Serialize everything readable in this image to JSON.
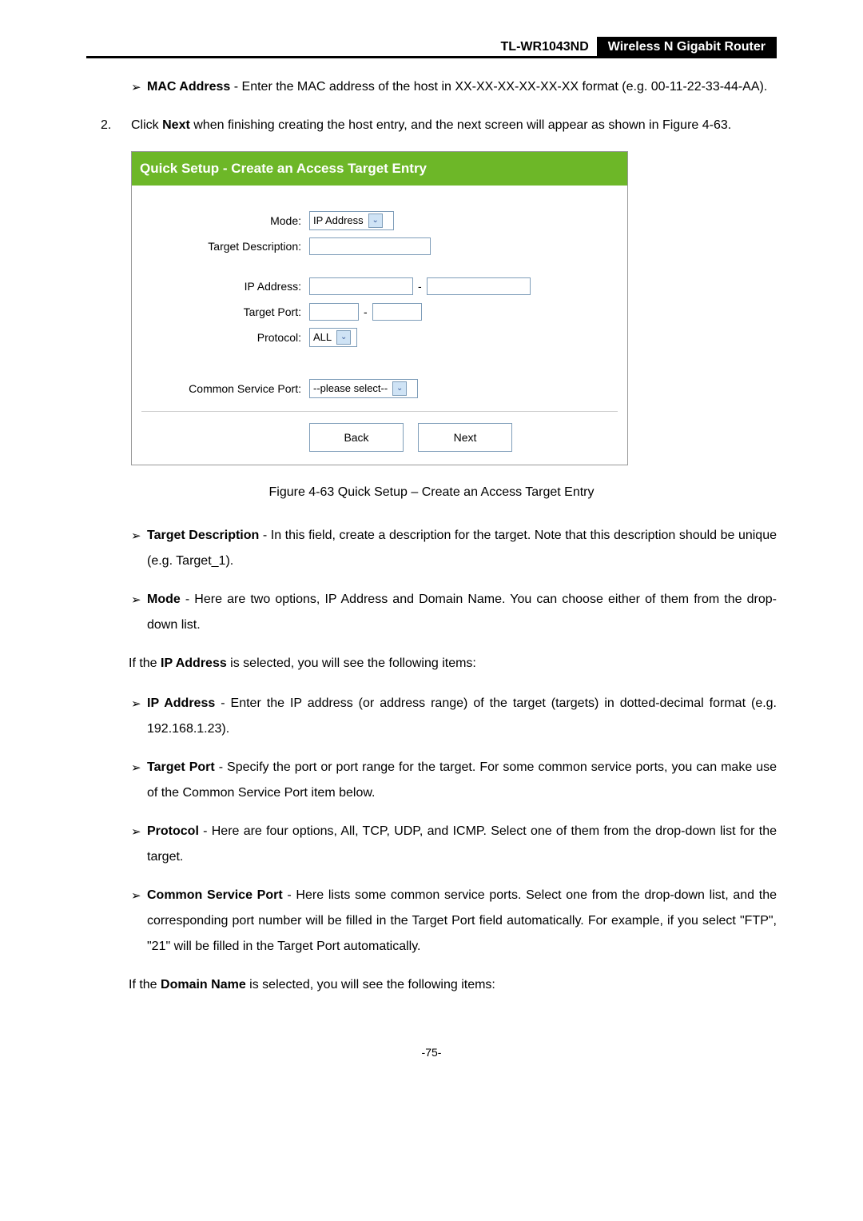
{
  "header": {
    "model": "TL-WR1043ND",
    "product": "Wireless N Gigabit Router"
  },
  "bullet_mac": {
    "term": "MAC Address",
    "text": " - Enter the MAC address of the host in XX-XX-XX-XX-XX-XX format (e.g. 00-11-22-33-44-AA)."
  },
  "step2": {
    "num": "2.",
    "pre": "Click ",
    "bold": "Next",
    "post": " when finishing creating the host entry, and the next screen will appear as shown in Figure 4-63."
  },
  "figure": {
    "title": "Quick Setup - Create an Access Target Entry",
    "labels": {
      "mode": "Mode:",
      "desc": "Target Description:",
      "ip": "IP Address:",
      "port": "Target Port:",
      "protocol": "Protocol:",
      "csp": "Common Service Port:"
    },
    "values": {
      "mode": "IP Address",
      "protocol": "ALL",
      "csp": "--please select--"
    },
    "buttons": {
      "back": "Back",
      "next": "Next"
    },
    "caption": "Figure 4-63    Quick Setup – Create an Access Target Entry"
  },
  "bullets2": {
    "target_desc": {
      "term": "Target Description",
      "text": " - In this field, create a description for the target. Note that this description should be unique (e.g. Target_1)."
    },
    "mode": {
      "term": "Mode",
      "text": " - Here are two options, IP Address and Domain Name. You can choose either of them from the drop-down list."
    }
  },
  "note1": {
    "pre": "If the ",
    "bold": "IP Address",
    "post": " is selected, you will see the following items:"
  },
  "bullets3": {
    "ip": {
      "term": "IP Address",
      "text": " - Enter the IP address (or address range) of the target (targets) in dotted-decimal format (e.g. 192.168.1.23)."
    },
    "port": {
      "term": "Target Port",
      "text": " - Specify the port or port range for the target. For some common service ports, you can make use of the Common Service Port item below."
    },
    "protocol": {
      "term": "Protocol",
      "text": " - Here are four options, All, TCP, UDP, and ICMP. Select one of them from the drop-down list for the target."
    },
    "csp": {
      "term": "Common Service Port",
      "text": " - Here lists some common service ports. Select one from the drop-down list, and the corresponding port number will be filled in the Target Port field automatically. For example, if you select \"FTP\", \"21\" will be filled in the Target Port automatically."
    }
  },
  "note2": {
    "pre": "If the ",
    "bold": "Domain Name",
    "post": " is selected, you will see the following items:"
  },
  "footer": {
    "page": "-75-"
  }
}
